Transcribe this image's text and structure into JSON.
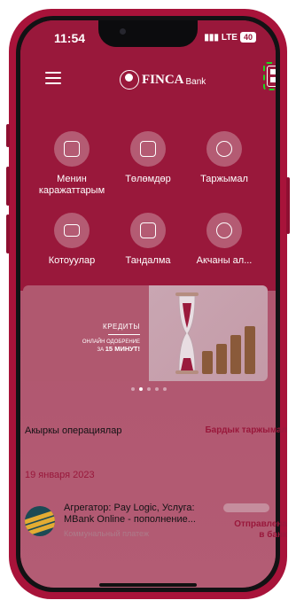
{
  "status_bar": {
    "time": "11:54",
    "network": "LTE",
    "battery": "40"
  },
  "header": {
    "brand": "FINCA",
    "brand_sub": "Bank",
    "menu_icon": "menu-icon",
    "qr_icon": "qr-code-icon"
  },
  "actions": [
    {
      "label": "Менин каражаттарым",
      "icon": "wallet-icon"
    },
    {
      "label": "Төлөмдөр",
      "icon": "payment-card-icon"
    },
    {
      "label": "Таржымал",
      "icon": "history-icon"
    },
    {
      "label": "Котоуулар",
      "icon": "transfer-icon"
    },
    {
      "label": "Тандалма",
      "icon": "favorites-icon"
    },
    {
      "label": "Акчаны ал...",
      "icon": "currency-exchange-icon"
    }
  ],
  "banner": {
    "title": "КРЕДИТЫ",
    "line1": "ОНЛАЙН ОДОБРЕНИЕ",
    "line2_prefix": "ЗА",
    "line2_highlight": "15 МИНУТ!"
  },
  "carousel": {
    "count": 5,
    "active": 1
  },
  "operations": {
    "section_title": "Акыркы операциялар",
    "all_link": "Бардык таржымал",
    "date": "19 января 2023",
    "items": [
      {
        "title": "Агрегатор: Pay Logic, Услуга: MBank Online - пополнение...",
        "subtitle": "Коммунальный платеж",
        "status": "Отправлена в банк",
        "icon": "mbank-logo-icon"
      }
    ]
  },
  "colors": {
    "brand": "#99183b",
    "highlight": "#1fd51f"
  }
}
